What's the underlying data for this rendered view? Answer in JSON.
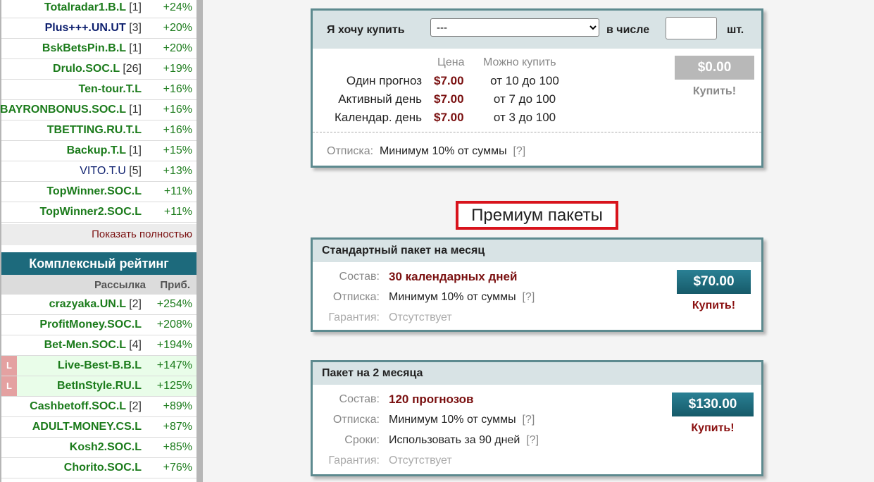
{
  "sidebar": {
    "top_rows": [
      {
        "name": "Totalradar1.B.L",
        "count": "[1]",
        "pct": "+24%",
        "style": "green"
      },
      {
        "name": "Plus+++.UN.UT",
        "count": "[3]",
        "pct": "+20%",
        "style": "bold-blue"
      },
      {
        "name": "BskBetsPin.B.L",
        "count": "[1]",
        "pct": "+20%",
        "style": "green"
      },
      {
        "name": "Drulo.SOC.L",
        "count": "[26]",
        "pct": "+19%",
        "style": "green"
      },
      {
        "name": "Ten-tour.T.L",
        "count": "",
        "pct": "+16%",
        "style": "green"
      },
      {
        "name": "BAYRONBONUS.SOC.L",
        "count": "[1]",
        "pct": "+16%",
        "style": "green"
      },
      {
        "name": "TBETTING.RU.T.L",
        "count": "",
        "pct": "+16%",
        "style": "green"
      },
      {
        "name": "Backup.T.L",
        "count": "[1]",
        "pct": "+15%",
        "style": "green"
      },
      {
        "name": "VITO.T.U",
        "count": "[5]",
        "pct": "+13%",
        "style": "blue"
      },
      {
        "name": "TopWinner.SOC.L",
        "count": "",
        "pct": "+11%",
        "style": "green"
      },
      {
        "name": "TopWinner2.SOC.L",
        "count": "",
        "pct": "+11%",
        "style": "green"
      }
    ],
    "show_full": "Показать полностью",
    "complex_title": "Комплексный рейтинг",
    "col_mailing": "Рассылка",
    "col_profit": "Приб.",
    "bottom_rows": [
      {
        "name": "crazyaka.UN.L",
        "count": "[2]",
        "pct": "+254%",
        "live": false
      },
      {
        "name": "ProfitMoney.SOC.L",
        "count": "",
        "pct": "+208%",
        "live": false
      },
      {
        "name": "Bet-Men.SOC.L",
        "count": "[4]",
        "pct": "+194%",
        "live": false
      },
      {
        "name": "Live-Best-B.B.L",
        "count": "",
        "pct": "+147%",
        "live": true
      },
      {
        "name": "BetInStyle.RU.L",
        "count": "",
        "pct": "+125%",
        "live": true
      },
      {
        "name": "Cashbetoff.SOC.L",
        "count": "[2]",
        "pct": "+89%",
        "live": false
      },
      {
        "name": "ADULT-MONEY.CS.L",
        "count": "",
        "pct": "+87%",
        "live": false
      },
      {
        "name": "Kosh2.SOC.L",
        "count": "",
        "pct": "+85%",
        "live": false
      },
      {
        "name": "Chorito.SOC.L",
        "count": "",
        "pct": "+76%",
        "live": false
      }
    ],
    "live_badge": "L"
  },
  "buy": {
    "want_label": "Я хочу купить",
    "select_value": "---",
    "in_number": "в числе",
    "qty_value": "",
    "pcs": "шт.",
    "col_price": "Цена",
    "col_can_buy": "Можно купить",
    "rows": [
      {
        "label": "Один прогноз",
        "price": "$7.00",
        "range": "от 10 до 100"
      },
      {
        "label": "Активный день",
        "price": "$7.00",
        "range": "от 7 до 100"
      },
      {
        "label": "Календар. день",
        "price": "$7.00",
        "range": "от 3 до 100"
      }
    ],
    "total": "$0.00",
    "buy_label": "Купить!",
    "otpiska_label": "Отписка:",
    "otpiska_value": "Минимум 10% от суммы",
    "help": "[?]"
  },
  "premium_title": "Премиум пакеты",
  "packages": [
    {
      "title": "Стандартный пакет на месяц",
      "composition_label": "Состав:",
      "composition_value": "30 календарных дней",
      "otpiska_label": "Отписка:",
      "otpiska_value": "Минимум 10% от суммы",
      "help": "[?]",
      "guarantee_label": "Гарантия:",
      "guarantee_value": "Отсутствует",
      "price": "$70.00",
      "buy_label": "Купить!"
    },
    {
      "title": "Пакет на 2 месяца",
      "composition_label": "Состав:",
      "composition_value": "120 прогнозов",
      "otpiska_label": "Отписка:",
      "otpiska_value": "Минимум 10% от суммы",
      "help": "[?]",
      "terms_label": "Сроки:",
      "terms_value": "Использовать за 90 дней",
      "terms_help": "[?]",
      "guarantee_label": "Гарантия:",
      "guarantee_value": "Отсутствует",
      "price": "$130.00",
      "buy_label": "Купить!"
    }
  ],
  "colors": {
    "accent_teal": "#1d6a7c",
    "price_red": "#7a1010",
    "premium_border": "#d8131c",
    "rating_green": "#1b7b1b"
  }
}
